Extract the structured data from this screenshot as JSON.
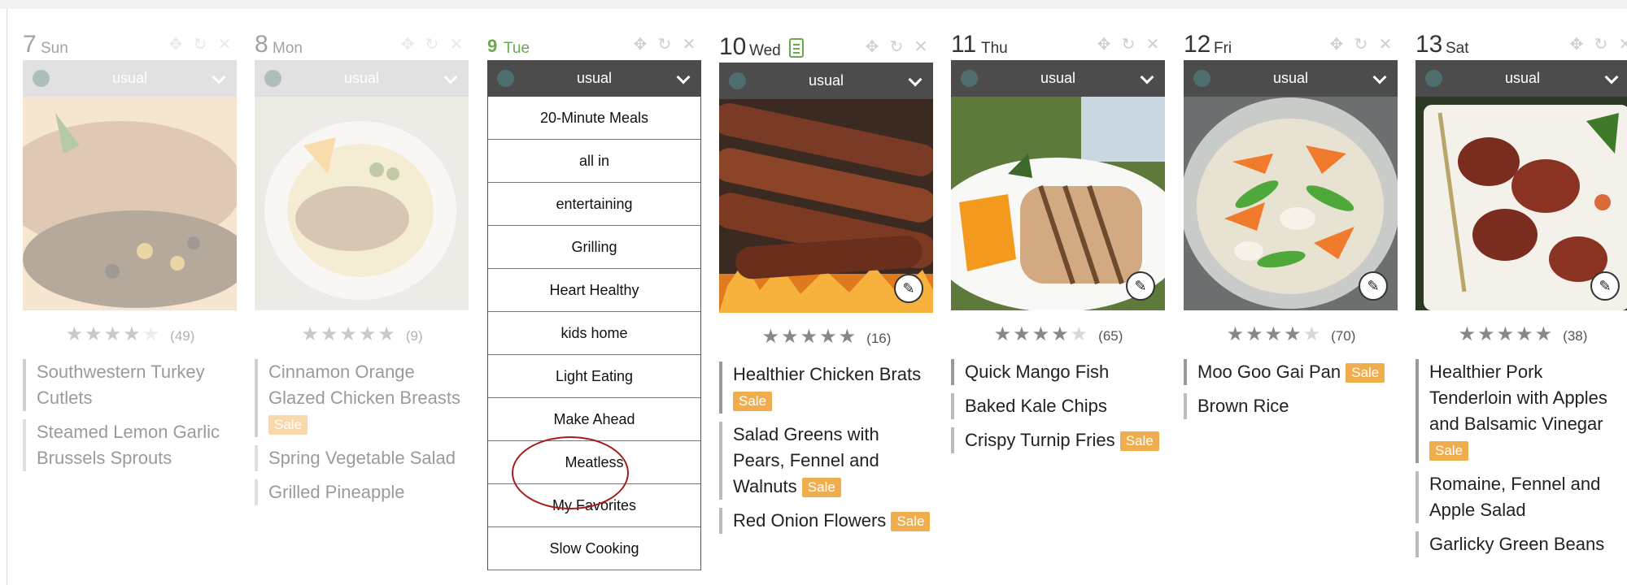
{
  "days": [
    {
      "num": "7",
      "name": "Sun",
      "plan": "usual",
      "rating": 4,
      "count": "(49)",
      "meals": [
        {
          "text": "Southwestern Turkey Cutlets",
          "sale": ""
        },
        {
          "text": "Steamed Lemon Garlic Brussels Sprouts",
          "sale": ""
        }
      ]
    },
    {
      "num": "8",
      "name": "Mon",
      "plan": "usual",
      "rating": 5,
      "count": "(9)",
      "meals": [
        {
          "text": "Cinnamon Orange Glazed Chicken Breasts",
          "sale": "Sale"
        },
        {
          "text": "Spring Vegetable Salad",
          "sale": ""
        },
        {
          "text": "Grilled Pineapple",
          "sale": ""
        }
      ]
    },
    {
      "num": "9",
      "name": "Tue",
      "plan": "usual"
    },
    {
      "num": "10",
      "name": "Wed",
      "plan": "usual",
      "rating": 5,
      "count": "(16)",
      "meals": [
        {
          "text": "Healthier Chicken Brats",
          "sale": "Sale"
        },
        {
          "text": "Salad Greens with Pears, Fennel and Walnuts",
          "sale": "Sale"
        },
        {
          "text": "Red Onion Flowers",
          "sale": "Sale"
        }
      ]
    },
    {
      "num": "11",
      "name": "Thu",
      "plan": "usual",
      "rating": 4,
      "count": "(65)",
      "meals": [
        {
          "text": "Quick Mango Fish",
          "sale": ""
        },
        {
          "text": "Baked Kale Chips",
          "sale": ""
        },
        {
          "text": "Crispy Turnip Fries",
          "sale": "Sale"
        }
      ]
    },
    {
      "num": "12",
      "name": "Fri",
      "plan": "usual",
      "rating": 4,
      "count": "(70)",
      "meals": [
        {
          "text": "Moo Goo Gai Pan",
          "sale": "Sale"
        },
        {
          "text": "Brown Rice",
          "sale": ""
        }
      ]
    },
    {
      "num": "13",
      "name": "Sat",
      "plan": "usual",
      "rating": 5,
      "count": "(38)",
      "meals": [
        {
          "text": "Healthier Pork Tenderloin with Apples and Balsamic Vinegar",
          "sale": "Sale"
        },
        {
          "text": "Romaine, Fennel and Apple Salad",
          "sale": ""
        },
        {
          "text": "Garlicky Green Beans",
          "sale": ""
        }
      ]
    }
  ],
  "dropdown_options": [
    "20-Minute Meals",
    "all in",
    "entertaining",
    "Grilling",
    "Heart Healthy",
    "kids home",
    "Light Eating",
    "Make Ahead",
    "Meatless",
    "My Favorites",
    "Slow Cooking"
  ],
  "icons": {
    "move": "move-icon",
    "refresh": "refresh-icon",
    "close": "close-icon",
    "edit": "pencil-icon",
    "recipe": "recipe-card-icon"
  },
  "colors": {
    "today": "#6aa84f",
    "sale": "#f0ad4e",
    "plan_bar": "#4c4c4c",
    "highlight_circle": "#a61c1c"
  }
}
